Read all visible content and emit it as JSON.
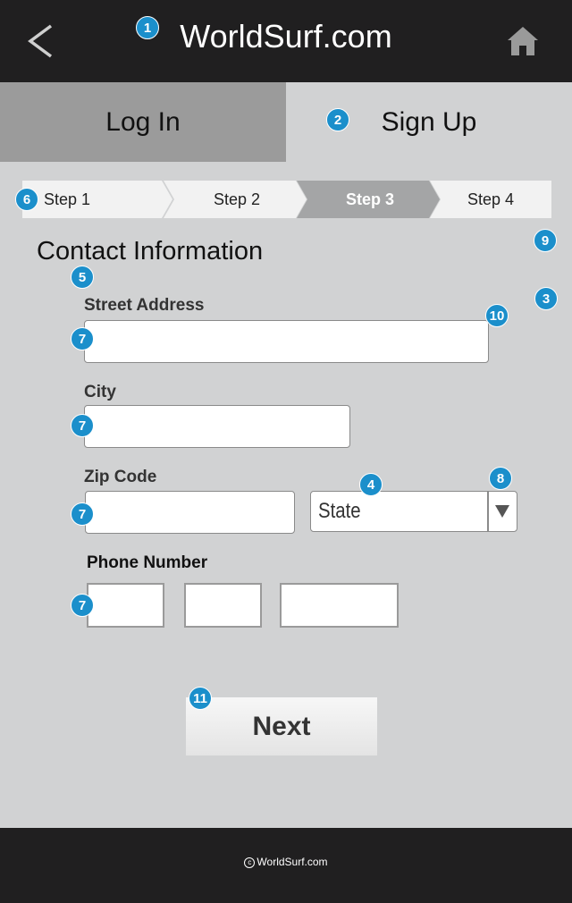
{
  "header": {
    "title": "WorldSurf.com",
    "back_icon": "chevron-left-icon",
    "home_icon": "home-icon"
  },
  "tabs": [
    {
      "label": "Log In",
      "active": false
    },
    {
      "label": "Sign Up",
      "active": true
    }
  ],
  "steps": [
    {
      "label": "Step 1",
      "active": false
    },
    {
      "label": "Step 2",
      "active": false
    },
    {
      "label": "Step 3",
      "active": true
    },
    {
      "label": "Step 4",
      "active": false
    }
  ],
  "form": {
    "section_title": "Contact Information",
    "street_label": "Street Address",
    "street_value": "",
    "city_label": "City",
    "city_value": "",
    "zip_label": "Zip Code",
    "zip_value": "",
    "state_value": "State",
    "phone_label": "Phone Number",
    "phone_values": [
      "",
      "",
      ""
    ]
  },
  "next_label": "Next",
  "footer": {
    "copyright": "WorldSurf.com",
    "copyright_symbol": "c"
  },
  "annotations": [
    "1",
    "2",
    "3",
    "4",
    "5",
    "6",
    "7",
    "8",
    "9",
    "10",
    "11"
  ],
  "colors": {
    "header_bg": "#201f20",
    "content_bg": "#d1d2d3",
    "inactive_tab_bg": "#9b9b9b",
    "active_step_bg": "#a4a5a6",
    "badge": "#1b8fcb"
  }
}
